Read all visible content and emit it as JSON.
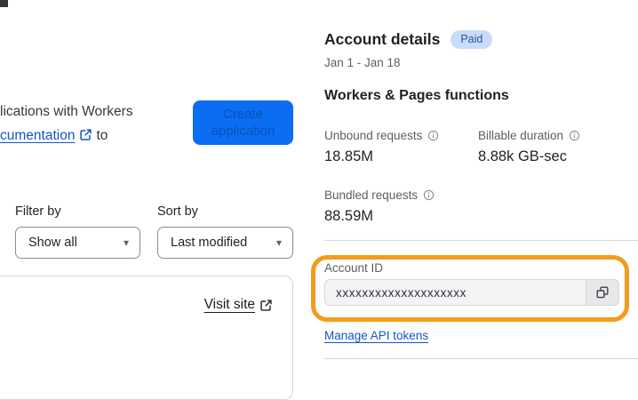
{
  "left_panel": {
    "intro_line1": "lications with Workers",
    "intro_link": "cumentation",
    "intro_suffix": "to",
    "create_button": {
      "label": "Create application"
    },
    "filter": {
      "label": "Filter by",
      "value": "Show all"
    },
    "sort": {
      "label": "Sort by",
      "value": "Last modified"
    },
    "card": {
      "visit_site_label": "Visit site"
    }
  },
  "account_panel": {
    "title": "Account details",
    "plan_badge": "Paid",
    "date_range": "Jan 1 - Jan 18",
    "section_title": "Workers & Pages functions",
    "stats": [
      {
        "label": "Unbound requests",
        "value": "18.85M"
      },
      {
        "label": "Billable duration",
        "value": "8.88k GB-sec"
      },
      {
        "label": "Bundled requests",
        "value": "88.59M"
      }
    ],
    "account_id": {
      "label": "Account ID",
      "value": "xxxxxxxxxxxxxxxxxxxx"
    },
    "manage_link": "Manage API tokens"
  },
  "icons": {
    "external-link-icon": "↗",
    "info-icon": "ⓘ",
    "copy-icon": "⧉",
    "caret-down-icon": "▾"
  },
  "colors": {
    "button_bg": "#0b6df2",
    "button_text": "#0a52b9",
    "link_blue": "#1256c4",
    "badge_bg": "#c8dcfa",
    "badge_text": "#2a549f",
    "highlight_orange": "#f59b1c"
  }
}
